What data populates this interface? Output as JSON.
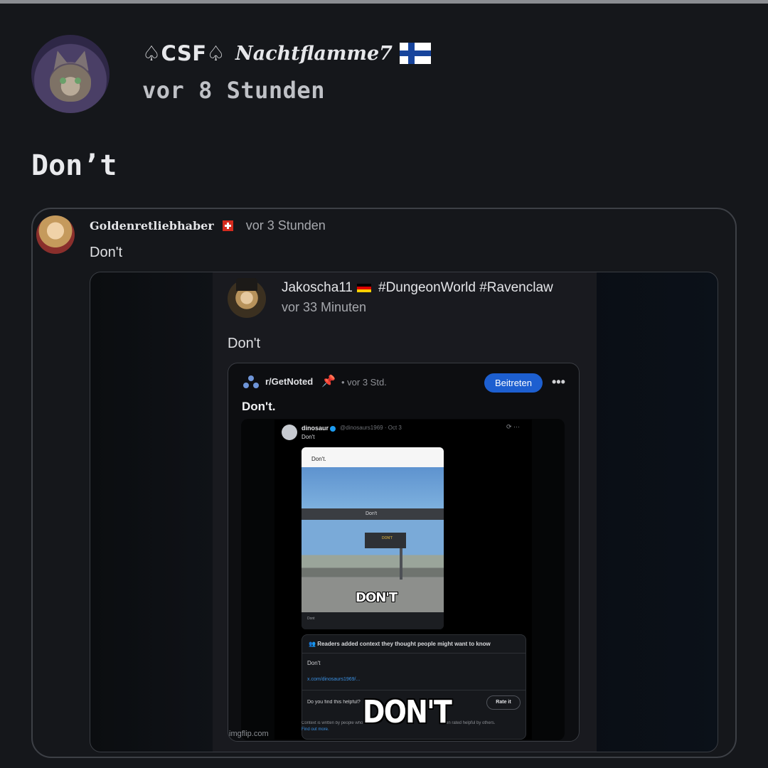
{
  "post": {
    "username_prefix": "♤CSF♤",
    "username_script": "Nachtflamme7",
    "flag": "finland-flag",
    "timestamp": "vor 8 Stunden",
    "body": "Don’t"
  },
  "quote1": {
    "username": "Goldenretliebhaber",
    "flag": "switzerland-flag",
    "timestamp": "vor 3 Stunden",
    "body": "Don't"
  },
  "quote2": {
    "username": "Jakoscha11",
    "tags": "#DungeonWorld #Ravenclaw",
    "flag": "germany-flag",
    "timestamp": "vor 33 Minuten",
    "body": "Don't"
  },
  "reddit": {
    "subreddit": "r/GetNoted",
    "time": "• vor 3 Std.",
    "join_label": "Beitreten",
    "more_label": "•••",
    "title": "Don't."
  },
  "tweet": {
    "name": "dinosaur",
    "handle": "@dinosaurs1969 · Oct 3",
    "menu": "⟳ ···",
    "text": "Don't",
    "meme_caption": "Don't.",
    "meme_bar": "Don't",
    "meme_sign": "DON'T",
    "meme_overlay": "DON'T",
    "meme_footer": "Dont"
  },
  "community_note": {
    "header": "Readers added context they thought people might want to know",
    "text": "Don't",
    "link": "x.com/dinosaurs1969/...",
    "question": "Do you find this helpful?",
    "rate_label": "Rate it",
    "footer_left": "Context is written by people who use X,",
    "footer_right": "then rated helpful by others.",
    "find_out_more": "Find out more."
  },
  "overlay_text": "DON'T",
  "watermark": "imgflip.com",
  "colors": {
    "background": "#15171b",
    "join_button": "#1d5fd0",
    "link": "#3a8fe0"
  }
}
